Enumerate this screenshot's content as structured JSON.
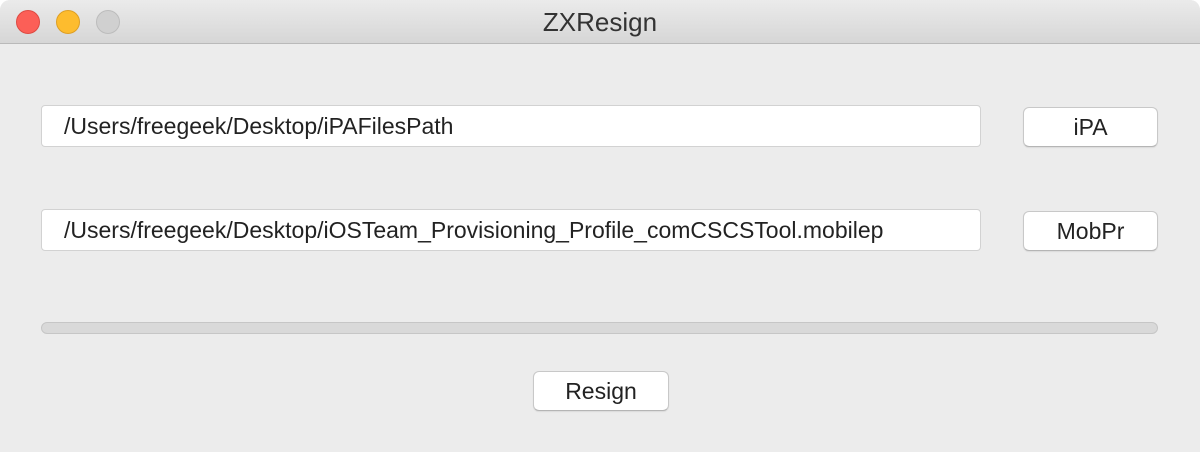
{
  "window": {
    "title": "ZXResign"
  },
  "ipa": {
    "path_value": "/Users/freegeek/Desktop/iPAFilesPath",
    "button_label": "iPA"
  },
  "profile": {
    "path_value": "/Users/freegeek/Desktop/iOSTeam_Provisioning_Profile_comCSCSTool.mobilep",
    "button_label": "MobPr"
  },
  "progress": {
    "fraction": 0
  },
  "actions": {
    "resign_label": "Resign"
  },
  "colors": {
    "close": "#fc5f57",
    "minimize": "#fdbc2e",
    "zoom_disabled": "#d0d0d0",
    "window_background": "#ececec"
  }
}
